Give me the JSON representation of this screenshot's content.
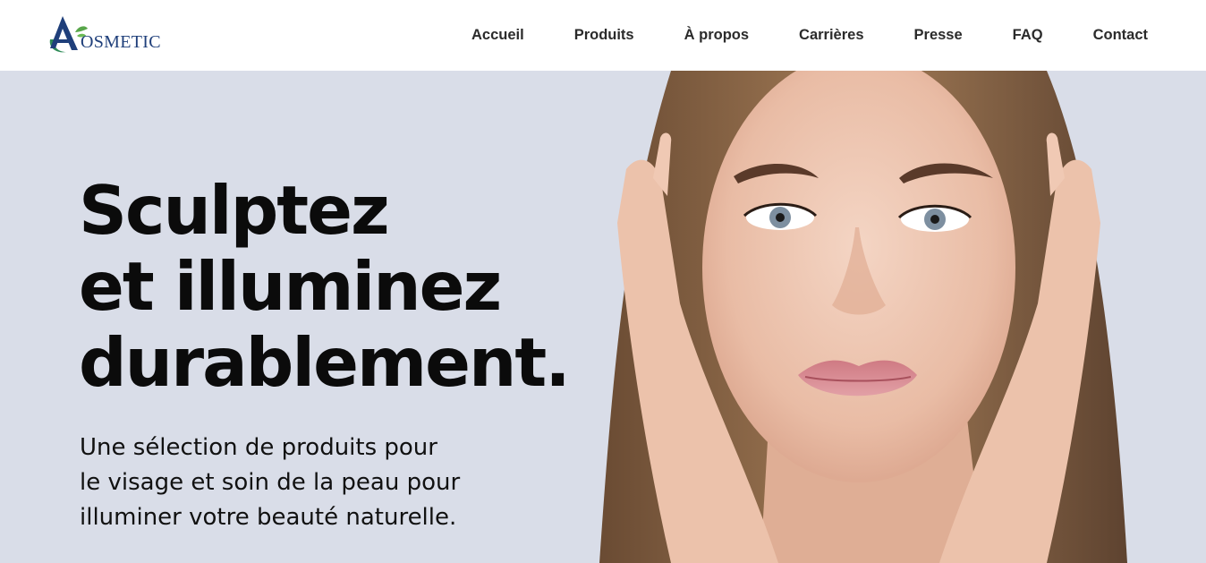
{
  "brand": {
    "name": "OSMETIC",
    "logo_icon": "leaf-a-monogram-icon",
    "colors": {
      "blue": "#1f3f7a",
      "green": "#2e8b57"
    }
  },
  "nav": {
    "items": [
      {
        "label": "Accueil"
      },
      {
        "label": "Produits"
      },
      {
        "label": "À propos"
      },
      {
        "label": "Carrières"
      },
      {
        "label": "Presse"
      },
      {
        "label": "FAQ"
      },
      {
        "label": "Contact"
      }
    ]
  },
  "hero": {
    "title_lines": [
      "Sculptez",
      "et illuminez",
      "durablement."
    ],
    "subtitle_lines": [
      "Une sélection de produits pour",
      "le visage et soin de la peau pour",
      "illuminer votre beauté naturelle."
    ],
    "background_color": "#d9dde8",
    "image_icon": "portrait-woman-skincare-photo"
  }
}
